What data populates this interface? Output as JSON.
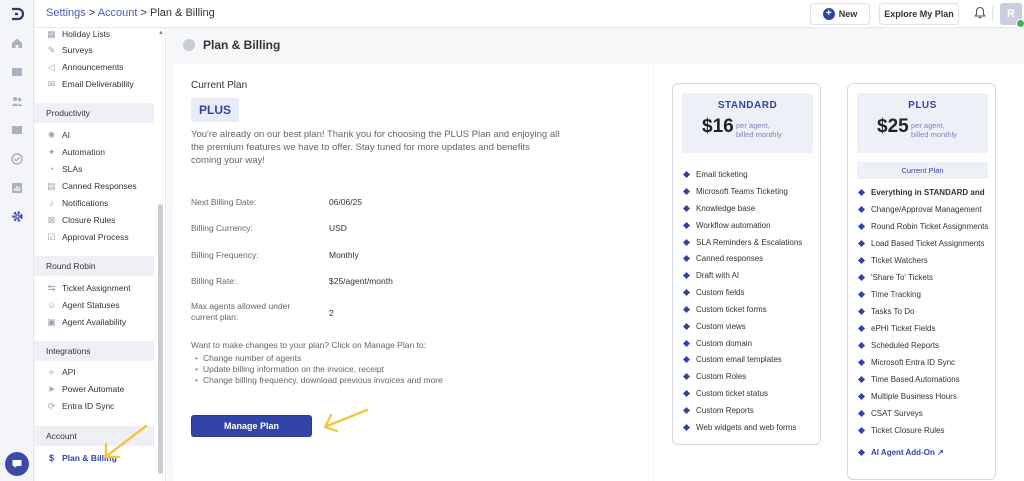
{
  "breadcrumb": {
    "settings": "Settings",
    "sep1": " > ",
    "account": "Account",
    "sep2": " > ",
    "current": "Plan & Billing"
  },
  "header": {
    "new_label": "New",
    "explore_label": "Explore My Plan",
    "avatar_initial": "R"
  },
  "sidebar": {
    "top_items": [
      {
        "label": "Holiday Lists",
        "icon": "calendar-icon"
      },
      {
        "label": "Surveys",
        "icon": "survey-icon"
      },
      {
        "label": "Announcements",
        "icon": "megaphone-icon"
      },
      {
        "label": "Email Deliverability",
        "icon": "mail-icon"
      }
    ],
    "sections": [
      {
        "heading": "Productivity",
        "items": [
          {
            "label": "AI",
            "icon": "ai-icon"
          },
          {
            "label": "Automation",
            "icon": "automation-icon"
          },
          {
            "label": "SLAs",
            "icon": "sla-icon"
          },
          {
            "label": "Canned Responses",
            "icon": "canned-icon"
          },
          {
            "label": "Notifications",
            "icon": "bell-icon"
          },
          {
            "label": "Closure Rules",
            "icon": "closure-icon"
          },
          {
            "label": "Approval Process",
            "icon": "approval-icon"
          }
        ]
      },
      {
        "heading": "Round Robin",
        "items": [
          {
            "label": "Ticket Assignment",
            "icon": "ticket-icon"
          },
          {
            "label": "Agent Statuses",
            "icon": "agent-icon"
          },
          {
            "label": "Agent Availability",
            "icon": "availability-icon"
          }
        ]
      },
      {
        "heading": "Integrations",
        "items": [
          {
            "label": "API",
            "icon": "api-icon"
          },
          {
            "label": "Power Automate",
            "icon": "power-icon"
          },
          {
            "label": "Entra ID Sync",
            "icon": "sync-icon"
          }
        ]
      },
      {
        "heading": "Account",
        "items": [
          {
            "label": "Plan & Billing",
            "icon": "dollar-icon",
            "active": true
          }
        ]
      }
    ]
  },
  "page": {
    "title": "Plan & Billing",
    "current_plan_label": "Current Plan",
    "plan_badge": "PLUS",
    "description": "You're already on our best plan! Thank you for choosing the PLUS Plan and enjoying all the premium features we have to offer. Stay tuned for more updates and benefits coming your way!",
    "details": [
      {
        "label": "Next Billing Date:",
        "value": "06/06/25"
      },
      {
        "label": "Billing Currency:",
        "value": "USD"
      },
      {
        "label": "Billing Frequency:",
        "value": "Monthly"
      },
      {
        "label": "Billing Rate:",
        "value": "$25/agent/month"
      },
      {
        "label": "Max agents allowed under current plan:",
        "value": "2"
      }
    ],
    "change_intro": "Want to make changes to your plan? Click on Manage Plan to:",
    "change_list": [
      "Change number of agents",
      "Update billing information on the invoice, receipt",
      "Change billing frequency, download previous invoices and more"
    ],
    "manage_button": "Manage Plan"
  },
  "plans": {
    "standard": {
      "name": "STANDARD",
      "price": "$16",
      "per_line1": "per agent,",
      "per_line2": "billed monthly",
      "features": [
        "Email ticketing",
        "Microsoft Teams Ticketing",
        "Knowledge base",
        "Workflow automation",
        "SLA Reminders & Escalations",
        "Canned responses",
        "Draft with AI",
        "Custom fields",
        "Custom ticket forms",
        "Custom views",
        "Custom domain",
        "Custom email templates",
        "Custom Roles",
        "Custom ticket status",
        "Custom Reports",
        "Web widgets and web forms"
      ]
    },
    "plus": {
      "name": "PLUS",
      "price": "$25",
      "per_line1": "per agent,",
      "per_line2": "billed monthly",
      "current_label": "Current Plan",
      "features": [
        "Everything in STANDARD and",
        "Change/Approval Management",
        "Round Robin Ticket Assignments",
        "Load Based Ticket Assignments",
        "Ticket Watchers",
        "'Share To' Tickets",
        "Time Tracking",
        "Tasks To Do",
        "ePHI Ticket Fields",
        "Scheduled Reports",
        "Microsoft Entra ID Sync",
        "Time Based Automations",
        "Multiple Business Hours",
        "CSAT Surveys",
        "Ticket Closure Rules"
      ],
      "addon": "AI Agent Add-On ↗"
    }
  },
  "colors": {
    "accent": "#3344a8",
    "badge_bg": "#e9ecf8",
    "annotation_arrow": "#f5c542"
  }
}
